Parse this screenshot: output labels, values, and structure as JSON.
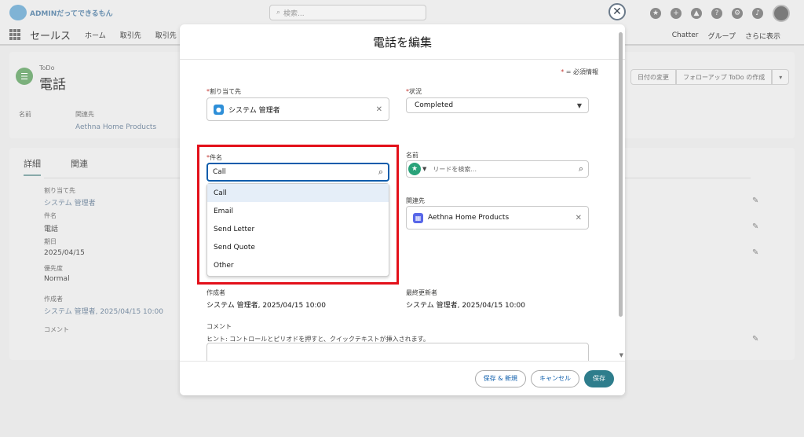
{
  "colors": {
    "accent": "#0b5cab",
    "highlight": "#e3101a",
    "primary_button": "#2e7d8c",
    "required": "#c23934"
  },
  "bg": {
    "logo_text": "ADMINだってできるもん",
    "search_placeholder": "検索...",
    "app_name": "セールス",
    "nav": {
      "home": "ホーム",
      "deals": "取引先",
      "deals2": "取引先",
      "chatter": "Chatter",
      "groups": "グループ",
      "more": "さらに表示"
    },
    "record_type": "ToDo",
    "record_title": "電話",
    "btn_change_date": "日付の変更",
    "btn_follow_up": "フォローアップ ToDo の作成",
    "hl": {
      "name_label": "名前",
      "related_label": "関連先",
      "related_value": "Aethna Home Products"
    },
    "tabs": {
      "detail": "詳細",
      "related": "関連"
    },
    "fields": {
      "assignee_label": "割り当て先",
      "assignee_value": "システム 管理者",
      "subject_label": "件名",
      "subject_value": "電話",
      "due_label": "期日",
      "due_value": "2025/04/15",
      "priority_label": "優先度",
      "priority_value": "Normal",
      "created_label": "作成者",
      "created_value": "システム 管理者, 2025/04/15 10:00",
      "comment_label": "コメント"
    }
  },
  "modal": {
    "title": "電話を編集",
    "required_note": "= 必須情報",
    "assignee": {
      "label": "割り当て先",
      "value": "システム 管理者"
    },
    "status": {
      "label": "状況",
      "value": "Completed"
    },
    "subject": {
      "label": "件名",
      "value": "Call"
    },
    "subject_options": [
      "Call",
      "Email",
      "Send Letter",
      "Send Quote",
      "Other"
    ],
    "name": {
      "label": "名前",
      "placeholder": "リードを検索..."
    },
    "related": {
      "label": "関連先",
      "value": "Aethna Home Products"
    },
    "created_by": {
      "label": "作成者",
      "value": "システム 管理者, 2025/04/15 10:00"
    },
    "modified_by": {
      "label": "最終更新者",
      "value": "システム 管理者, 2025/04/15 10:00"
    },
    "comment": {
      "label": "コメント",
      "hint": "ヒント: コントロールとピリオドを押すと、クイックテキストが挿入されます。"
    },
    "buttons": {
      "save_new": "保存 & 新規",
      "cancel": "キャンセル",
      "save": "保存"
    }
  }
}
